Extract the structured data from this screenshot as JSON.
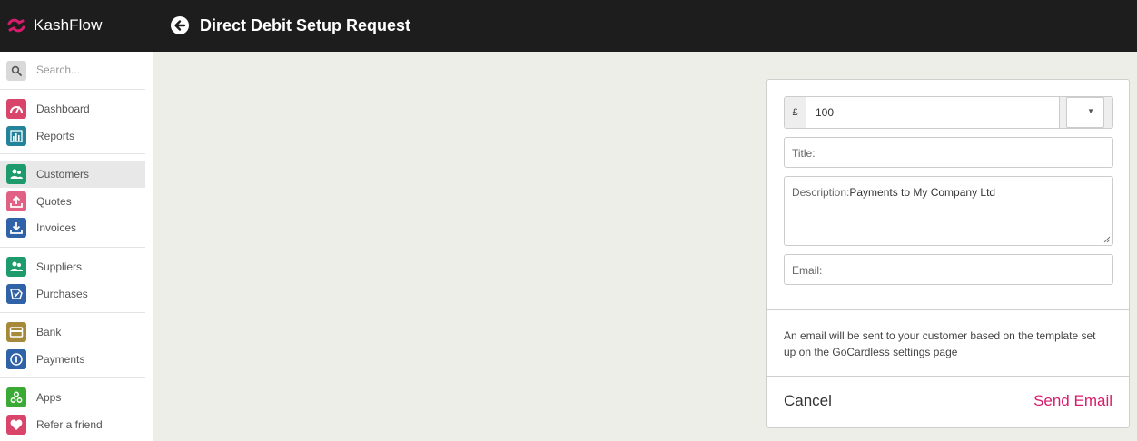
{
  "brand": {
    "name": "KashFlow",
    "color": "#d61d6d"
  },
  "header": {
    "title": "Direct Debit Setup Request",
    "back_icon": "arrow-left-circle-icon"
  },
  "sidebar": {
    "search_placeholder": "Search...",
    "items": [
      {
        "label": "Dashboard",
        "icon": "gauge-icon",
        "color": "#d9446b"
      },
      {
        "label": "Reports",
        "icon": "bar-chart-icon",
        "color": "#23839b"
      },
      {
        "label": "Customers",
        "icon": "users-icon",
        "color": "#1e9b6c",
        "active": true
      },
      {
        "label": "Quotes",
        "icon": "upload-tray-icon",
        "color": "#e06183"
      },
      {
        "label": "Invoices",
        "icon": "download-tray-icon",
        "color": "#2f62a7"
      },
      {
        "label": "Suppliers",
        "icon": "users-icon",
        "color": "#1e9b6c"
      },
      {
        "label": "Purchases",
        "icon": "basket-icon",
        "color": "#2f62a7"
      },
      {
        "label": "Bank",
        "icon": "card-icon",
        "color": "#a7893a"
      },
      {
        "label": "Payments",
        "icon": "coin-icon",
        "color": "#2f62a7"
      },
      {
        "label": "Apps",
        "icon": "apps-icon",
        "color": "#3aaa35"
      },
      {
        "label": "Refer a friend",
        "icon": "heart-icon",
        "color": "#d9446b"
      }
    ]
  },
  "form": {
    "currency_symbol": "£",
    "amount": "100",
    "title_label": "Title:",
    "description_label": "Description:",
    "description_value": "Payments to My Company Ltd",
    "email_label": "Email:",
    "info_text": "An email will be sent to your customer based on the template set up on the GoCardless settings page",
    "cancel_label": "Cancel",
    "send_label": "Send Email"
  }
}
